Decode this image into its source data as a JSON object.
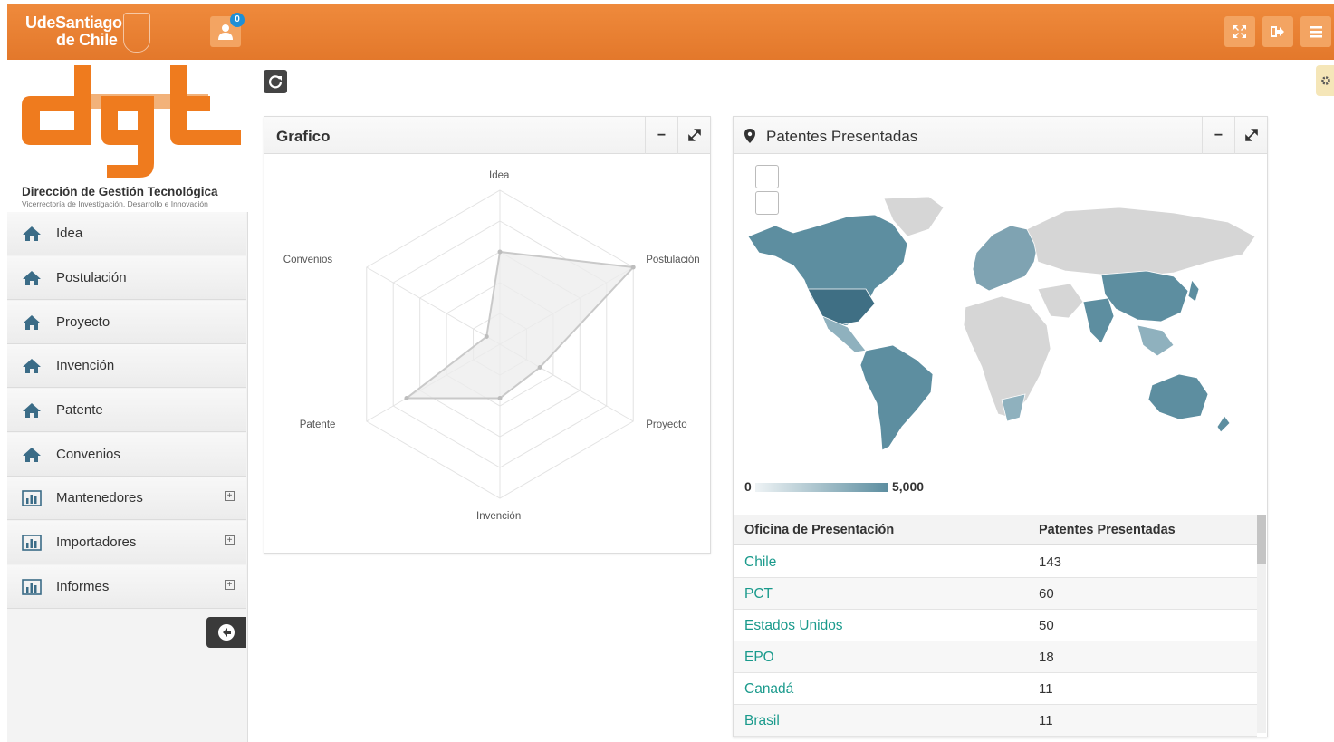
{
  "header": {
    "brand_line1": "UdeSantiago",
    "brand_line2": "de Chile",
    "notification_count": "0"
  },
  "logo": {
    "text": "dgt",
    "subtitle": "Dirección de Gestión Tecnológica",
    "subtitle2": "Vicerrectoría de Investigación, Desarrollo e Innovación",
    "color": "#ef7b1e"
  },
  "sidebar": {
    "items": [
      {
        "label": "Idea",
        "icon": "home-icon"
      },
      {
        "label": "Postulación",
        "icon": "home-icon"
      },
      {
        "label": "Proyecto",
        "icon": "home-icon"
      },
      {
        "label": "Invención",
        "icon": "home-icon"
      },
      {
        "label": "Patente",
        "icon": "home-icon"
      },
      {
        "label": "Convenios",
        "icon": "home-icon"
      },
      {
        "label": "Mantenedores",
        "icon": "bar-chart-icon",
        "expandable": true
      },
      {
        "label": "Importadores",
        "icon": "bar-chart-icon",
        "expandable": true
      },
      {
        "label": "Informes",
        "icon": "bar-chart-icon",
        "expandable": true
      }
    ]
  },
  "grafico": {
    "title": "Grafico"
  },
  "chart_data": {
    "type": "radar",
    "axes": [
      "Idea",
      "Postulación",
      "Proyecto",
      "Invención",
      "Patente",
      "Convenios"
    ],
    "values": [
      0.6,
      1.0,
      0.3,
      0.35,
      0.7,
      0.1
    ],
    "grid_levels": 5,
    "fill": "#ececec",
    "stroke": "#c9c9c9"
  },
  "patentes": {
    "title": "Patentes Presentadas",
    "legend_min": "0",
    "legend_max": "5,000",
    "columns": [
      "Oficina de Presentación",
      "Patentes Presentadas"
    ],
    "rows": [
      {
        "office": "Chile",
        "count": "143"
      },
      {
        "office": "PCT",
        "count": "60"
      },
      {
        "office": "Estados Unidos",
        "count": "50"
      },
      {
        "office": "EPO",
        "count": "18"
      },
      {
        "office": "Canadá",
        "count": "11"
      },
      {
        "office": "Brasil",
        "count": "11"
      }
    ]
  },
  "colors": {
    "topbar": "#e8802f",
    "map_dark": "#5d8ea0",
    "map_light": "#d6d6d6",
    "link": "#1a9a8c"
  }
}
